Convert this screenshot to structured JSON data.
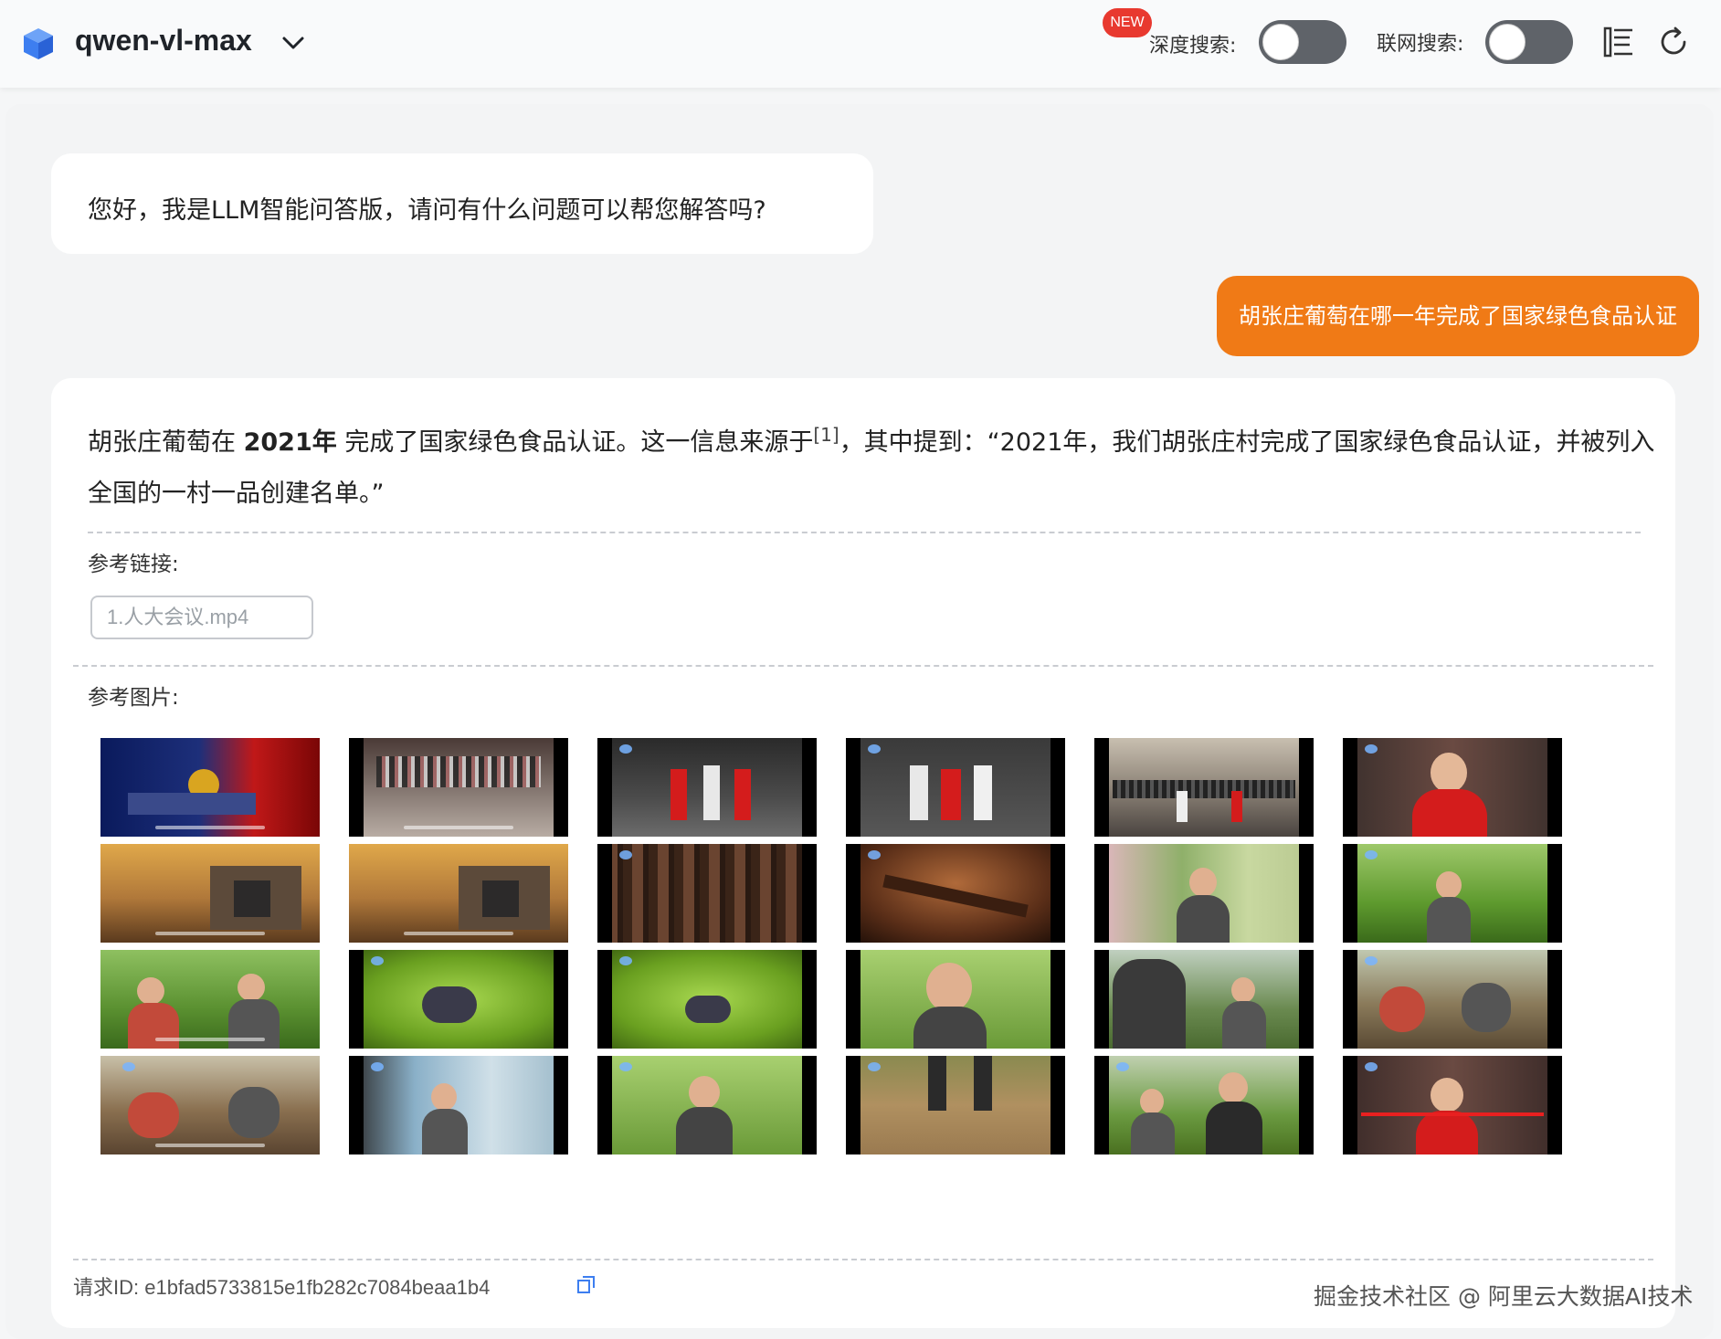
{
  "header": {
    "model_name": "qwen-vl-max",
    "new_badge": "NEW",
    "deep_search_label": "深度搜索:",
    "web_search_label": "联网搜索:",
    "deep_search_on": false,
    "web_search_on": false
  },
  "chat": {
    "greeting": "您好，我是LLM智能问答版，请问有什么问题可以帮您解答吗?",
    "user_question": "胡张庄葡萄在哪一年完成了国家绿色食品认证",
    "answer": {
      "part1": "胡张庄葡萄在 ",
      "year": "2021年",
      "part2": " 完成了国家绿色食品认证。这一信息来源于",
      "cite": "[1]",
      "part3": "，其中提到：“2021年，我们胡张庄村完成了国家绿色食品认证，并被列入全国的一村一品创建名单。”"
    },
    "ref_links_label": "参考链接:",
    "ref_links": [
      "1.人大会议.mp4"
    ],
    "ref_images_label": "参考图片:",
    "request_id_label": "请求ID:",
    "request_id": "e1bfad5733815e1fb282c7084beaa1b4"
  },
  "watermark": "掘金技术社区 @ 阿里云大数据AI技术",
  "colors": {
    "accent_orange": "#f07a16",
    "badge_red": "#e8392f",
    "toggle_off": "#5f6369",
    "logo_blue": "#3d7ef0"
  },
  "icons": [
    "cube-logo-icon",
    "chevron-down-icon",
    "history-list-icon",
    "refresh-icon",
    "copy-icon"
  ]
}
